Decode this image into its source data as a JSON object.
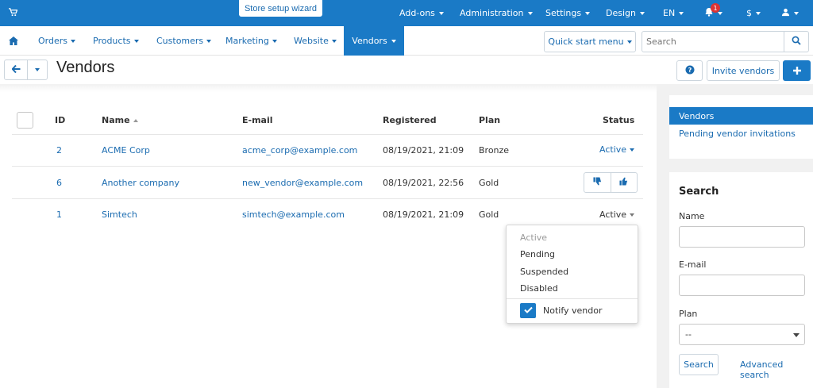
{
  "topbar": {
    "wizard_label": "Store setup wizard",
    "menus": [
      "Add-ons",
      "Administration",
      "Settings",
      "Design",
      "EN"
    ],
    "notifications_count": "1",
    "currency": "$"
  },
  "nav": {
    "items": [
      "Orders",
      "Products",
      "Customers",
      "Marketing",
      "Website",
      "Vendors"
    ],
    "quick_start": "Quick start menu",
    "search_placeholder": "Search"
  },
  "page": {
    "title": "Vendors",
    "invite_label": "Invite vendors"
  },
  "table": {
    "headers": {
      "id": "ID",
      "name": "Name",
      "email": "E-mail",
      "registered": "Registered",
      "plan": "Plan",
      "status": "Status"
    },
    "rows": [
      {
        "id": "2",
        "name": "ACME Corp",
        "email": "acme_corp@example.com",
        "registered": "08/19/2021, 21:09",
        "plan": "Bronze",
        "status": "Active"
      },
      {
        "id": "6",
        "name": "Another company",
        "email": "new_vendor@example.com",
        "registered": "08/19/2021, 22:56",
        "plan": "Gold",
        "status": ""
      },
      {
        "id": "1",
        "name": "Simtech",
        "email": "simtech@example.com",
        "registered": "08/19/2021, 21:09",
        "plan": "Gold",
        "status": "Active"
      }
    ]
  },
  "status_dropdown": {
    "options": [
      "Active",
      "Pending",
      "Suspended",
      "Disabled"
    ],
    "notify_label": "Notify vendor",
    "notify_checked": true
  },
  "sidebar": {
    "sections": [
      "Vendors",
      "Pending vendor invitations"
    ],
    "search_title": "Search",
    "name_label": "Name",
    "email_label": "E-mail",
    "plan_label": "Plan",
    "plan_value": "--",
    "search_button": "Search",
    "advanced_link": "Advanced search"
  },
  "colors": {
    "primary": "#1a7ac6",
    "link": "#1a6bb0",
    "badge": "#dd3333"
  }
}
